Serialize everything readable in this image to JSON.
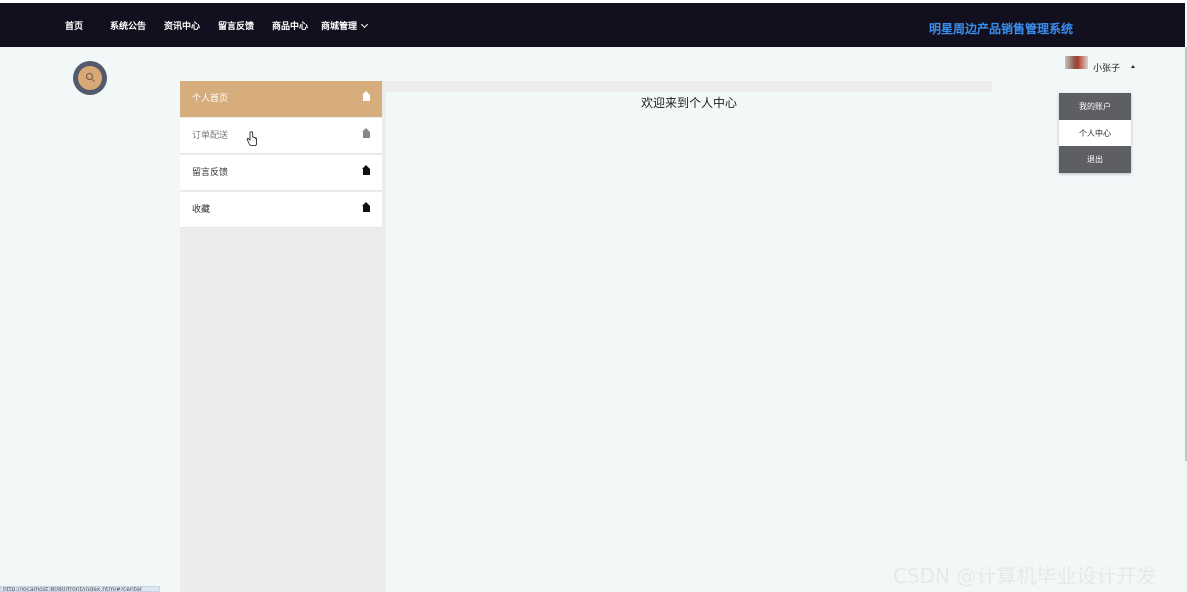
{
  "nav": {
    "items": [
      "首页",
      "系统公告",
      "资讯中心",
      "留言反馈",
      "商品中心",
      "商城管理"
    ],
    "site_title": "明星周边产品销售管理系统"
  },
  "search": {
    "icon": "search-icon"
  },
  "sidebar": {
    "items": [
      {
        "label": "个人首页",
        "icon": "home-icon",
        "active": true
      },
      {
        "label": "订单配送",
        "icon": "home-icon"
      },
      {
        "label": "留言反馈",
        "icon": "home-icon"
      },
      {
        "label": "收藏",
        "icon": "home-icon"
      }
    ]
  },
  "content": {
    "title": "欢迎来到个人中心"
  },
  "user": {
    "name": "小张子",
    "menu": [
      "我的账户",
      "个人中心",
      "退出"
    ]
  },
  "watermark": "CSDN @计算机毕业设计开发",
  "status_url": "http://localhost:8080/front/index.html#/center",
  "colors": {
    "topbar": "#12101e",
    "site_title": "#3a8ef0",
    "accent": "#d8ad7e",
    "dropdown_dark": "#5d5f62"
  }
}
